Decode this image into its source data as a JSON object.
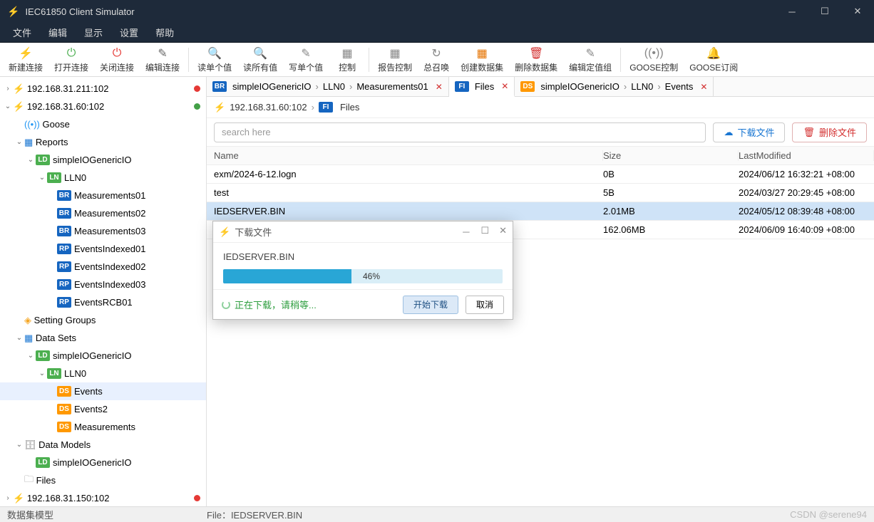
{
  "window": {
    "title": "IEC61850 Client Simulator"
  },
  "menus": [
    "文件",
    "编辑",
    "显示",
    "设置",
    "帮助"
  ],
  "toolbar": [
    {
      "label": "新建连接",
      "icon": "⚡",
      "color": "#e57300"
    },
    {
      "label": "打开连接",
      "icon": "⏻",
      "color": "#4caf50"
    },
    {
      "label": "关闭连接",
      "icon": "⏻",
      "color": "#e53935"
    },
    {
      "label": "编辑连接",
      "icon": "✎",
      "color": "#666"
    },
    {
      "sep": true
    },
    {
      "label": "读单个值",
      "icon": "🔍",
      "color": "#888"
    },
    {
      "label": "读所有值",
      "icon": "🔍",
      "color": "#888"
    },
    {
      "label": "写单个值",
      "icon": "✎",
      "color": "#888"
    },
    {
      "label": "控制",
      "icon": "▦",
      "color": "#888"
    },
    {
      "sep": true
    },
    {
      "label": "报告控制",
      "icon": "▦",
      "color": "#888"
    },
    {
      "label": "总召唤",
      "icon": "↻",
      "color": "#888"
    },
    {
      "label": "创建数据集",
      "icon": "▦",
      "color": "#e57300"
    },
    {
      "label": "删除数据集",
      "icon": "🗑",
      "color": "#d32f2f"
    },
    {
      "label": "编辑定值组",
      "icon": "✎",
      "color": "#888"
    },
    {
      "sep": true
    },
    {
      "label": "GOOSE控制",
      "icon": "((•))",
      "color": "#888"
    },
    {
      "label": "GOOSE订阅",
      "icon": "🔔",
      "color": "#888"
    }
  ],
  "connections": [
    {
      "addr": "192.168.31.211:102",
      "dot": "red"
    },
    {
      "addr": "192.168.31.60:102",
      "dot": "green"
    },
    {
      "addr": "192.168.31.150:102",
      "dot": "red"
    }
  ],
  "tree": {
    "goose": "Goose",
    "reports": "Reports",
    "ld": "simpleIOGenericIO",
    "ln": "LLN0",
    "brs": [
      "Measurements01",
      "Measurements02",
      "Measurements03"
    ],
    "rps": [
      "EventsIndexed01",
      "EventsIndexed02",
      "EventsIndexed03",
      "EventsRCB01"
    ],
    "setting": "Setting Groups",
    "datasets": "Data Sets",
    "ds_items": [
      "Events",
      "Events2",
      "Measurements"
    ],
    "datamodels": "Data Models",
    "files": "Files"
  },
  "tabs": [
    {
      "badge": "BR",
      "cls": "b-br",
      "seg1": "simpleIOGenericIO",
      "seg2": "LLN0",
      "seg3": "Measurements01"
    },
    {
      "badge": "FI",
      "cls": "b-fi",
      "seg1": "Files",
      "active": true
    },
    {
      "badge": "DS",
      "cls": "b-ds",
      "seg1": "simpleIOGenericIO",
      "seg2": "LLN0",
      "seg3": "Events"
    }
  ],
  "breadcrumb": {
    "addr": "192.168.31.60:102",
    "badge": "FI",
    "page": "Files"
  },
  "actions": {
    "search_ph": "search here",
    "download": "下载文件",
    "delete": "删除文件"
  },
  "table": {
    "headers": {
      "name": "Name",
      "size": "Size",
      "mod": "LastModified"
    },
    "rows": [
      {
        "name": "exm/2024-6-12.logn",
        "size": "0B",
        "mod": "2024/06/12 16:32:21 +08:00"
      },
      {
        "name": "test",
        "size": "5B",
        "mod": "2024/03/27 20:29:45 +08:00"
      },
      {
        "name": "IEDSERVER.BIN",
        "size": "2.01MB",
        "mod": "2024/05/12 08:39:48 +08:00",
        "sel": true
      },
      {
        "name": "",
        "size": "162.06MB",
        "mod": "2024/06/09 16:40:09 +08:00"
      }
    ]
  },
  "dialog": {
    "title": "下载文件",
    "file": "IEDSERVER.BIN",
    "pct": "46%",
    "pct_val": 46,
    "status": "正在下载，请稍等...",
    "start": "开始下载",
    "cancel": "取消"
  },
  "status": {
    "left": "数据集模型",
    "mid": "File：IEDSERVER.BIN",
    "right": "CSDN @serene94"
  }
}
